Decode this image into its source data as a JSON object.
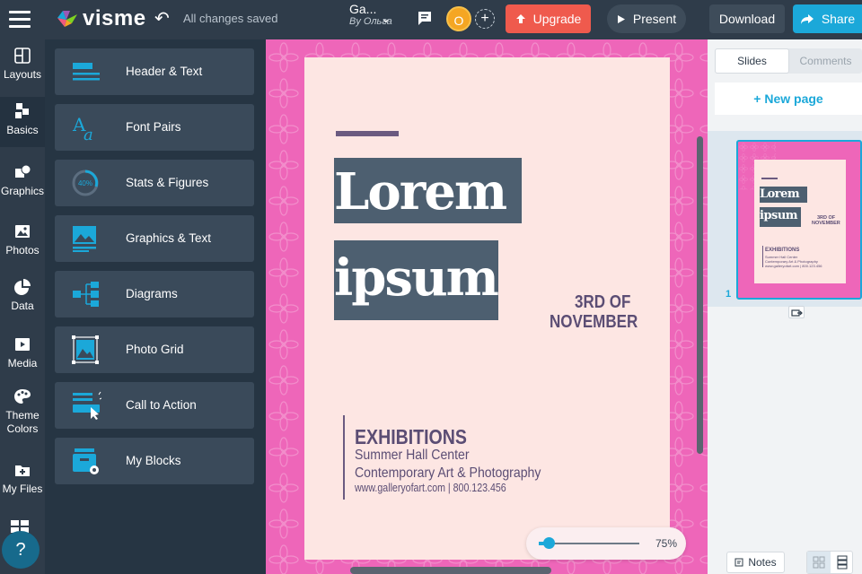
{
  "topbar": {
    "brand": "visme",
    "saved_status": "All changes saved",
    "doc_title": "Ga...",
    "doc_author": "By Ольга",
    "avatar_initial": "O",
    "upgrade_label": "Upgrade",
    "present_label": "Present",
    "download_label": "Download",
    "share_label": "Share"
  },
  "leftnav": {
    "items": [
      {
        "label": "Layouts",
        "icon": "layouts-icon"
      },
      {
        "label": "Basics",
        "icon": "basics-icon"
      },
      {
        "label": "Graphics",
        "icon": "graphics-icon"
      },
      {
        "label": "Photos",
        "icon": "photos-icon"
      },
      {
        "label": "Data",
        "icon": "data-icon"
      },
      {
        "label": "Media",
        "icon": "media-icon"
      },
      {
        "label": "Theme",
        "icon": "theme-colors-icon"
      },
      {
        "label": "Colors",
        "icon": ""
      },
      {
        "label": "My Files",
        "icon": "my-files-icon"
      }
    ],
    "help_label": "?"
  },
  "panel": {
    "blocks": [
      {
        "label": "Header & Text",
        "icon": "header-text-icon"
      },
      {
        "label": "Font Pairs",
        "icon": "font-pairs-icon"
      },
      {
        "label": "Stats & Figures",
        "icon": "stats-figures-icon",
        "badge": "40%"
      },
      {
        "label": "Graphics & Text",
        "icon": "graphics-text-icon"
      },
      {
        "label": "Diagrams",
        "icon": "diagrams-icon"
      },
      {
        "label": "Photo Grid",
        "icon": "photo-grid-icon"
      },
      {
        "label": "Call to Action",
        "icon": "call-to-action-icon"
      },
      {
        "label": "My Blocks",
        "icon": "my-blocks-icon"
      }
    ]
  },
  "slide": {
    "line1": "Lorem",
    "line2": "ipsum",
    "date1": "3RD OF",
    "date2": "NOVEMBER",
    "ex_title": "EXHIBITIONS",
    "ex_line1": "Summer Hall Center",
    "ex_line2": "Contemporary Art & Photography",
    "ex_line3": "www.galleryofart.com | 800.123.456"
  },
  "zoom": {
    "value": "75%",
    "level": 0.1
  },
  "rpanel": {
    "tab_slides": "Slides",
    "tab_comments": "Comments",
    "new_page": "+ New page",
    "slide_number": "1",
    "thumb": {
      "line1": "Lorem",
      "line2": "ipsum",
      "date1": "3RD OF",
      "date2": "NOVEMBER",
      "ex_title": "EXHIBITIONS",
      "ex_line1": "Summer Hall Center",
      "ex_line2": "Contemporary Art & Photography",
      "ex_line3": "www.galleryofart.com | 800.123.456"
    },
    "notes_label": "Notes"
  },
  "colors": {
    "accent": "#1ba8d9",
    "upgrade": "#ef5a4d",
    "background_pink": "#ee66b9",
    "page_bg": "#fde6e3",
    "text_purple": "#5b4d74",
    "box_slate": "#4d5f70"
  }
}
